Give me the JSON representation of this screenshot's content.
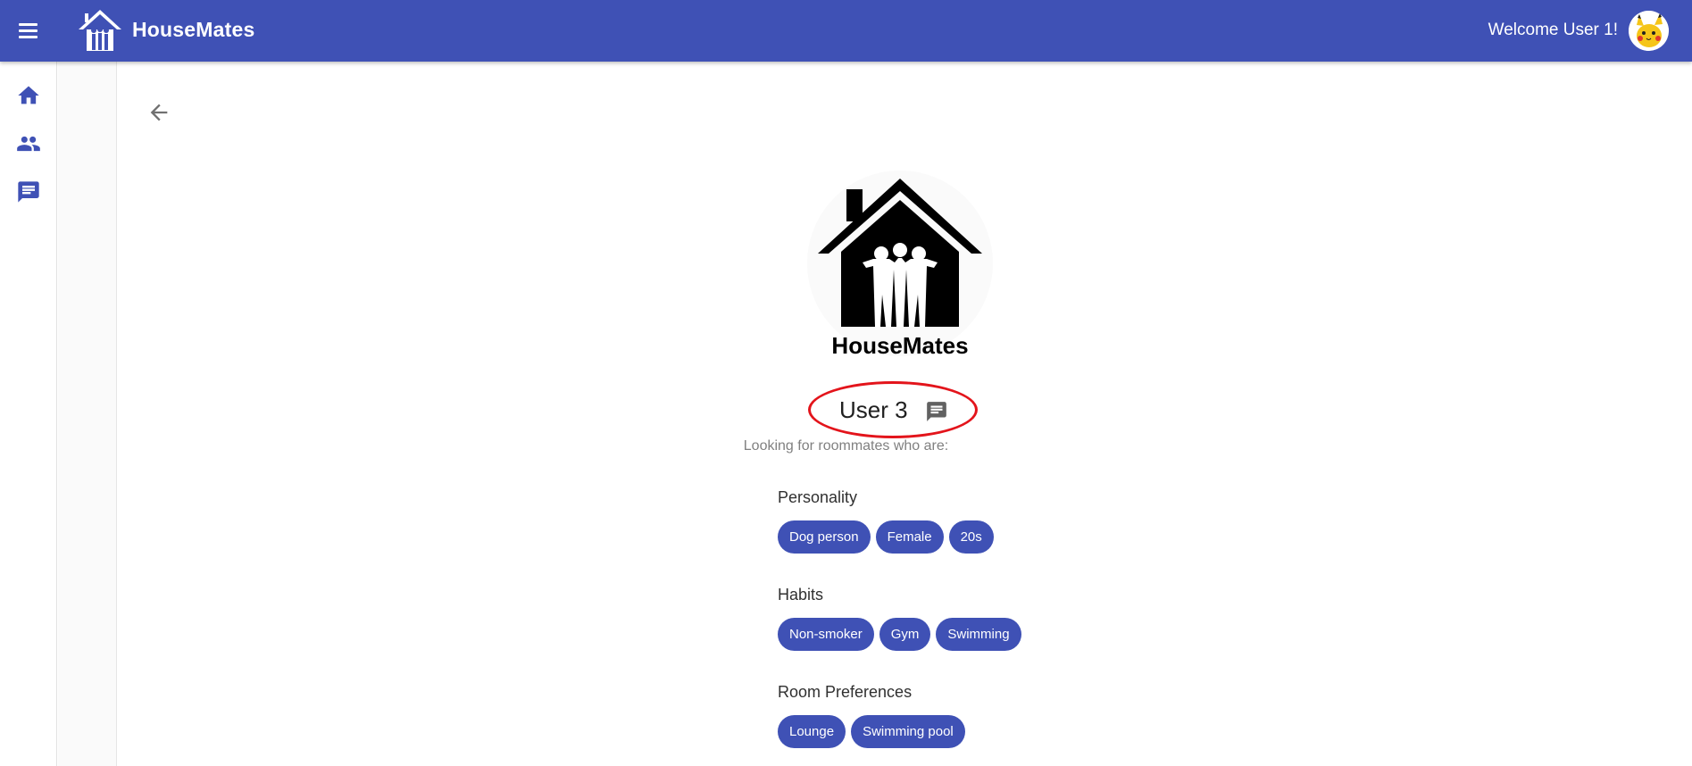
{
  "header": {
    "app_title": "HouseMates",
    "welcome_text": "Welcome User 1!",
    "menu_icon": "hamburger-menu-icon",
    "avatar_icon": "pikachu-avatar"
  },
  "sidebar": {
    "items": [
      {
        "icon": "home-icon"
      },
      {
        "icon": "people-icon"
      },
      {
        "icon": "chat-icon"
      }
    ]
  },
  "profile": {
    "logo_text": "HouseMates",
    "name": "User 3",
    "message_icon": "chat-icon",
    "subtitle": "Looking for roommates who are:",
    "sections": [
      {
        "title": "Personality",
        "chips": [
          "Dog person",
          "Female",
          "20s"
        ]
      },
      {
        "title": "Habits",
        "chips": [
          "Non-smoker",
          "Gym",
          "Swimming"
        ]
      },
      {
        "title": "Room Preferences",
        "chips": [
          "Lounge",
          "Swimming pool"
        ]
      }
    ]
  },
  "colors": {
    "primary": "#3f51b5",
    "highlight_oval": "#e3141b"
  }
}
